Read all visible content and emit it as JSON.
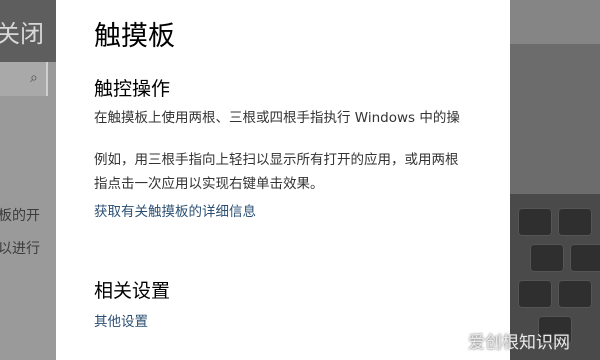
{
  "background_left": {
    "title_fragment": "关闭",
    "line1_fragment": "板的开",
    "line2_fragment": "以进行"
  },
  "panel": {
    "title": "触摸板",
    "touch_section": {
      "heading": "触控操作",
      "line1": "在触摸板上使用两根、三根或四根手指执行 Windows 中的操",
      "line2": "例如，用三根手指向上轻扫以显示所有打开的应用，或用两根",
      "line3": "指点击一次应用以实现右键单击效果。",
      "link": "获取有关触摸板的详细信息"
    },
    "related_section": {
      "heading": "相关设置",
      "link": "其他设置"
    }
  },
  "watermark": "爱创根知识网",
  "colors": {
    "link": "#2b4f73",
    "panel_bg": "#ffffff",
    "overlay_bg": "#6a6a6a"
  }
}
